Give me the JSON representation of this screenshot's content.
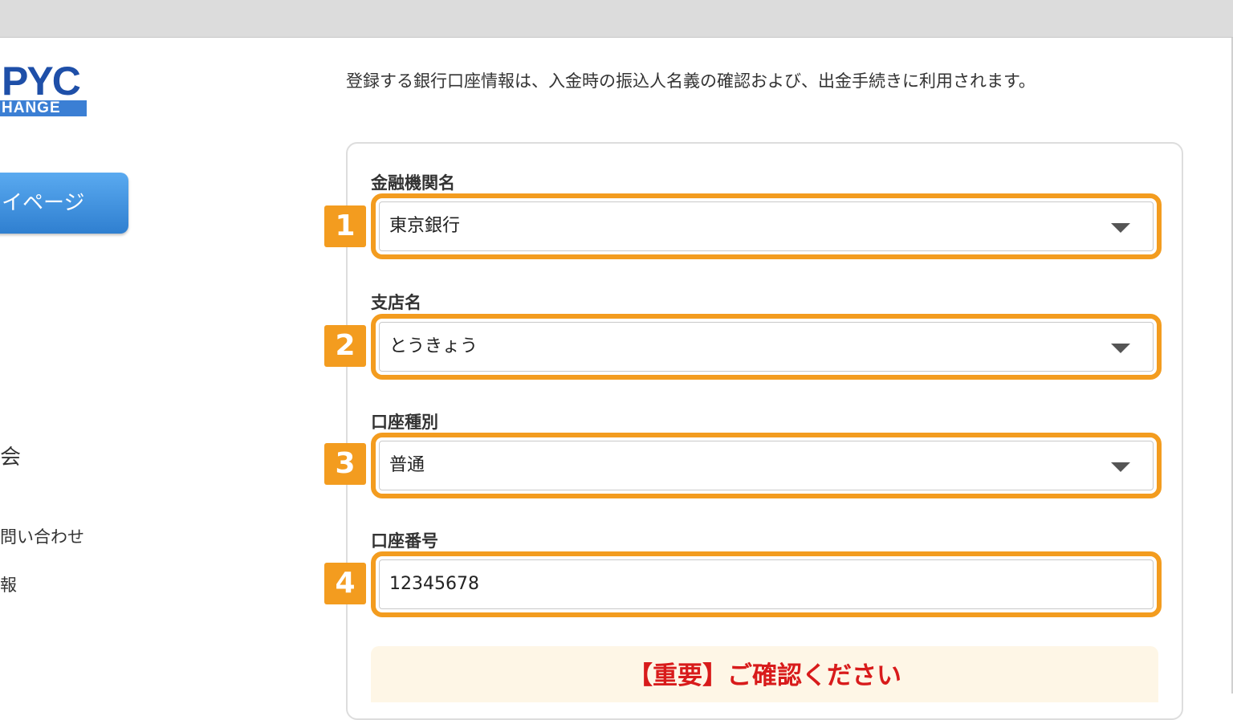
{
  "logo": {
    "top": "PYC",
    "bottom": "HANGE"
  },
  "sidebar": {
    "mypage_button": "イページ",
    "items": [
      "会",
      "問い合わせ",
      "報"
    ]
  },
  "intro_text": "登録する銀行口座情報は、入金時の振込人名義の確認および、出金手続きに利用されます。",
  "form": {
    "fields": [
      {
        "badge": "1",
        "label": "金融機関名",
        "value": "東京銀行",
        "type": "select"
      },
      {
        "badge": "2",
        "label": "支店名",
        "value": "とうきょう",
        "type": "select"
      },
      {
        "badge": "3",
        "label": "口座種別",
        "value": "普通",
        "type": "select"
      },
      {
        "badge": "4",
        "label": "口座番号",
        "value": "12345678",
        "type": "text"
      }
    ],
    "notice": "【重要】ご確認ください"
  },
  "colors": {
    "highlight": "#f39c1f",
    "notice_text": "#d81b1b",
    "notice_bg": "#fef6e6",
    "button_blue": "#3b8fe0"
  }
}
